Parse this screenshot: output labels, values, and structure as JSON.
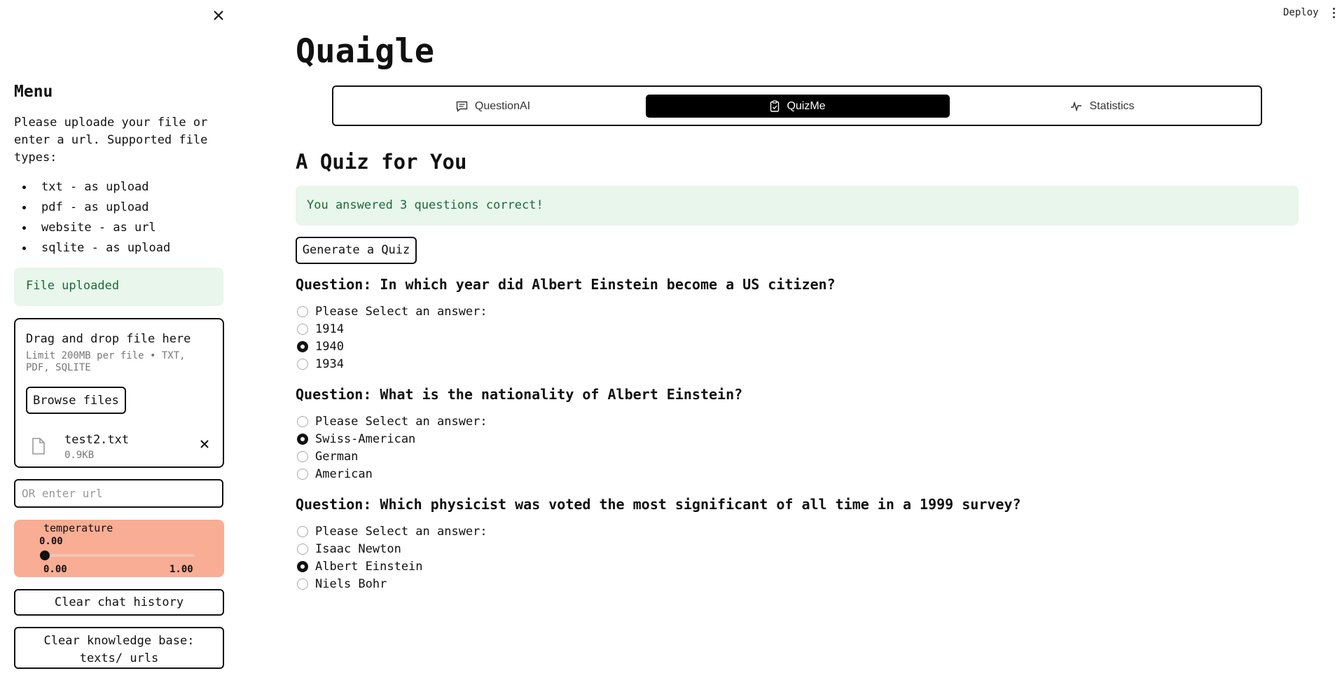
{
  "sidebar": {
    "menu_title": "Menu",
    "intro": "Please uploade your file or enter a url. Supported file types:",
    "file_types": [
      "txt - as upload",
      "pdf - as upload",
      "website - as url",
      "sqlite - as upload"
    ],
    "upload_status": "File uploaded",
    "uploader": {
      "drop_title": "Drag and drop file here",
      "limit": "Limit 200MB per file • TXT, PDF, SQLITE",
      "browse_label": "Browse files",
      "file_name": "test2.txt",
      "file_size": "0.9KB"
    },
    "url_placeholder": "OR enter url",
    "slider": {
      "label": "temperature",
      "value": "0.00",
      "min": "0.00",
      "max": "1.00",
      "fraction": 0
    },
    "clear_chat_label": "Clear chat history",
    "clear_kb_label": "Clear knowledge base: texts/ urls"
  },
  "header": {
    "deploy_label": "Deploy"
  },
  "main": {
    "title": "Quaigle",
    "tabs": [
      {
        "label": "QuestionAI",
        "icon": "chat-icon",
        "active": false
      },
      {
        "label": "QuizMe",
        "icon": "clipboard-icon",
        "active": true
      },
      {
        "label": "Statistics",
        "icon": "pulse-icon",
        "active": false
      }
    ],
    "section_title": "A Quiz for You",
    "result_message": "You answered 3 questions correct!",
    "generate_label": "Generate a Quiz",
    "questions": [
      {
        "title": "Question: In which year did Albert Einstein become a US citizen?",
        "options": [
          "Please Select an answer:",
          "1914",
          "1940",
          "1934"
        ],
        "selected": 2
      },
      {
        "title": "Question: What is the nationality of Albert Einstein?",
        "options": [
          "Please Select an answer:",
          "Swiss-American",
          "German",
          "American"
        ],
        "selected": 1
      },
      {
        "title": "Question: Which physicist was voted the most significant of all time in a 1999 survey?",
        "options": [
          "Please Select an answer:",
          "Isaac Newton",
          "Albert Einstein",
          "Niels Bohr"
        ],
        "selected": 2
      }
    ]
  },
  "colors": {
    "success_bg": "#e8f6ec",
    "success_text": "#1c6b36",
    "slider_bg": "#f8ad94",
    "active_tab": "#000000"
  }
}
